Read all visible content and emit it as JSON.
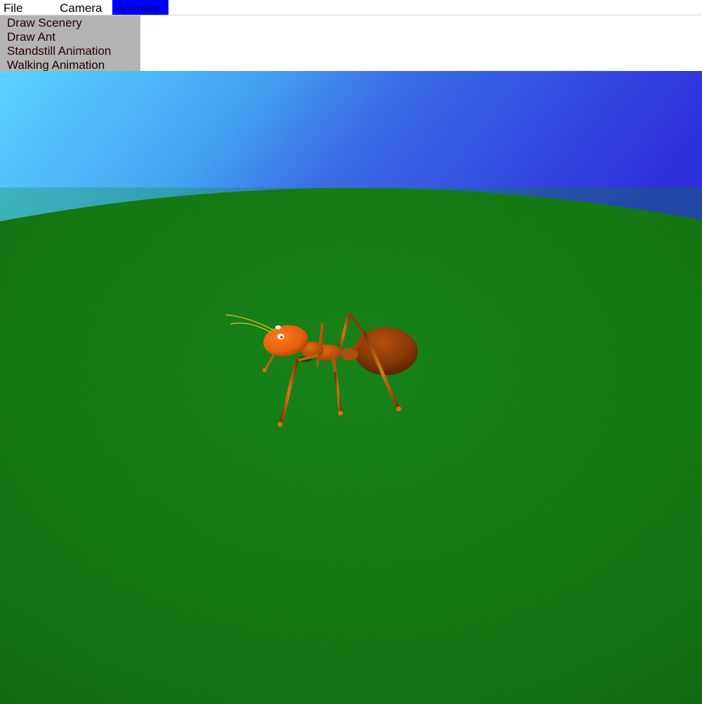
{
  "menubar": {
    "items": [
      {
        "label": "File"
      },
      {
        "label": "Camera"
      },
      {
        "label": "Animate"
      }
    ],
    "active_index": 2,
    "active_bg": "#0000ff",
    "active_fg": "#000080"
  },
  "dropdown": {
    "items": [
      {
        "label": "Draw Scenery"
      },
      {
        "label": "Draw Ant"
      },
      {
        "label": "Standstill Animation"
      },
      {
        "label": "Walking Animation"
      }
    ],
    "bg": "#b3b3b3"
  },
  "scene": {
    "sky_colors": [
      "#55ccff",
      "#3c78e8",
      "#2f32dd"
    ],
    "ground_color": "#1c7a1c",
    "ant_color": "#d65a10"
  }
}
